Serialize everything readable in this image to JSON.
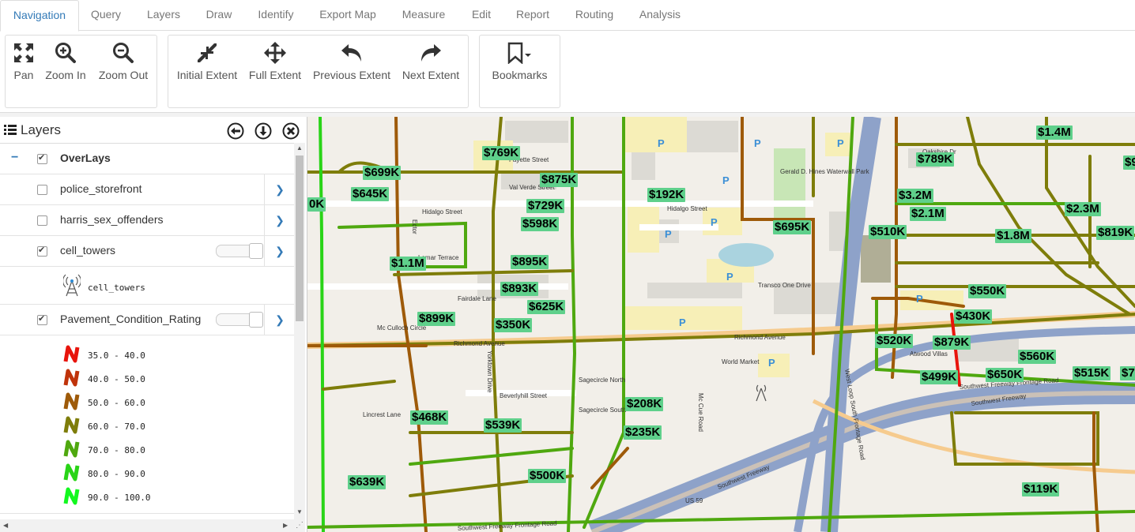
{
  "tabs": [
    {
      "label": "Navigation",
      "active": true
    },
    {
      "label": "Query"
    },
    {
      "label": "Layers"
    },
    {
      "label": "Draw"
    },
    {
      "label": "Identify"
    },
    {
      "label": "Export Map"
    },
    {
      "label": "Measure"
    },
    {
      "label": "Edit"
    },
    {
      "label": "Report"
    },
    {
      "label": "Routing"
    },
    {
      "label": "Analysis"
    }
  ],
  "ribbon": {
    "pan": "Pan",
    "zoom_in": "Zoom In",
    "zoom_out": "Zoom Out",
    "initial_extent": "Initial Extent",
    "full_extent": "Full Extent",
    "previous_extent": "Previous Extent",
    "next_extent": "Next Extent",
    "bookmarks": "Bookmarks"
  },
  "layers_panel": {
    "title": "Layers",
    "group": "OverLays",
    "layers": [
      {
        "name": "police_storefront",
        "checked": false
      },
      {
        "name": "harris_sex_offenders",
        "checked": false
      },
      {
        "name": "cell_towers",
        "checked": true
      },
      {
        "name": "Pavement_Condition_Rating",
        "checked": true
      }
    ],
    "cell_towers_legend": "cell_towers",
    "pavement_legend": [
      {
        "label": "35.0 - 40.0",
        "color": "#e8140c"
      },
      {
        "label": "40.0 - 50.0",
        "color": "#c0330a"
      },
      {
        "label": "50.0 - 60.0",
        "color": "#9e5a09"
      },
      {
        "label": "60.0 - 70.0",
        "color": "#7e7d0a"
      },
      {
        "label": "70.0 - 80.0",
        "color": "#4fa80f"
      },
      {
        "label": "80.0 - 90.0",
        "color": "#29d417"
      },
      {
        "label": "90.0 - 100.0",
        "color": "#12f81f"
      }
    ]
  },
  "map": {
    "streets": {
      "fayette": "Fayette Street",
      "val_verde": "Val Verde Street",
      "hidalgo": "Hidalgo Street",
      "hidalgo2": "Hidalgo Street",
      "fairdale": "Fairdale Lane",
      "mcculloch": "Mc Culloch Circle",
      "richmond": "Richmond Avenue",
      "richmond2": "Richmond Avenue",
      "sagecircle_n": "Sagecircle North",
      "sagecircle_s": "Sagecircle South",
      "beverlyhill": "Beverlyhill Street",
      "lincrest": "Lincrest Lane",
      "sw_freeway": "Southwest Freeway",
      "sw_freeway2": "Southwest Freeway",
      "sw_frontage": "Southwest Freeway Frontage Road",
      "sw_frontage2": "Southwest Freeway Frontage Road",
      "transco": "Transco One Drive",
      "world_market": "World Market",
      "atwood": "Atwood Villas",
      "hines": "Gerald D. Hines Waterwall Park",
      "us59": "US 59",
      "westloop": "West Loop South Frontage Road",
      "mccue": "Mc Cue Road",
      "oakshire": "Oakshire Dr",
      "ector": "Ector",
      "lamar": "Lamar Terrace",
      "yorktown": "Yorktown Drive"
    },
    "prices": [
      "$769K",
      "$699K",
      "$875K",
      "$645K",
      "$729K",
      "$598K",
      "$192K",
      "$1.1M",
      "$895K",
      "$893K",
      "$625K",
      "$899K",
      "$350K",
      "$695K",
      "$1.4M",
      "$789K",
      "$3.2M",
      "$2.1M",
      "$2.3M",
      "$510K",
      "$1.8M",
      "$819K",
      "$550K",
      "$430K",
      "$520K",
      "$879K",
      "$560K",
      "$499K",
      "$650K",
      "$515K",
      "$468K",
      "$539K",
      "$208K",
      "$235K",
      "$639K",
      "$500K",
      "$119K",
      "$7",
      "$9",
      "0K"
    ]
  }
}
